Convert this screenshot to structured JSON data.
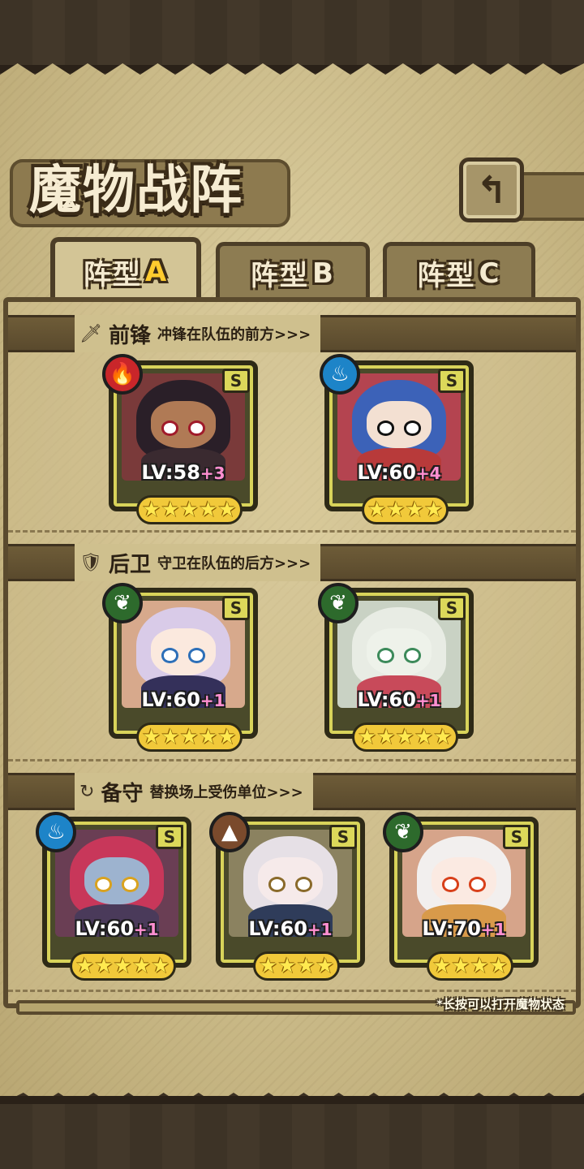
{
  "title": "魔物战阵",
  "tabs": [
    {
      "prefix": "阵型",
      "suffix": "A",
      "active": true
    },
    {
      "prefix": "阵型",
      "suffix": "B",
      "active": false
    },
    {
      "prefix": "阵型",
      "suffix": "C",
      "active": false
    }
  ],
  "sections": {
    "vanguard": {
      "name": "前锋",
      "desc": "冲锋在队伍的前方>>>"
    },
    "rearguard": {
      "name": "后卫",
      "desc": "守卫在队伍的后方>>>"
    },
    "reserve": {
      "name": "备守",
      "desc": "替换场上受伤单位>>>"
    }
  },
  "cards": {
    "v1": {
      "lv": "LV:58",
      "plus": "+3",
      "rank": "S",
      "element": "fire",
      "stars": 5
    },
    "v2": {
      "lv": "LV:60",
      "plus": "+4",
      "rank": "S",
      "element": "water",
      "stars": 4
    },
    "r1": {
      "lv": "LV:60",
      "plus": "+1",
      "rank": "S",
      "element": "wood",
      "stars": 5
    },
    "r2": {
      "lv": "LV:60",
      "plus": "+1",
      "rank": "S",
      "element": "wood",
      "stars": 5
    },
    "b1": {
      "lv": "LV:60",
      "plus": "+1",
      "rank": "S",
      "element": "water",
      "stars": 5
    },
    "b2": {
      "lv": "LV:60",
      "plus": "+1",
      "rank": "S",
      "element": "earth",
      "stars": 4
    },
    "b3": {
      "lv": "LV:70",
      "plus": "+1",
      "rank": "S",
      "element": "wood",
      "stars": 4
    }
  },
  "hint": "*长按可以打开魔物状态",
  "colors": {
    "active_tab_suffix": "#ffcb2e",
    "level_plus": "#ff8fd1",
    "card_frame": "#d8d35a"
  }
}
